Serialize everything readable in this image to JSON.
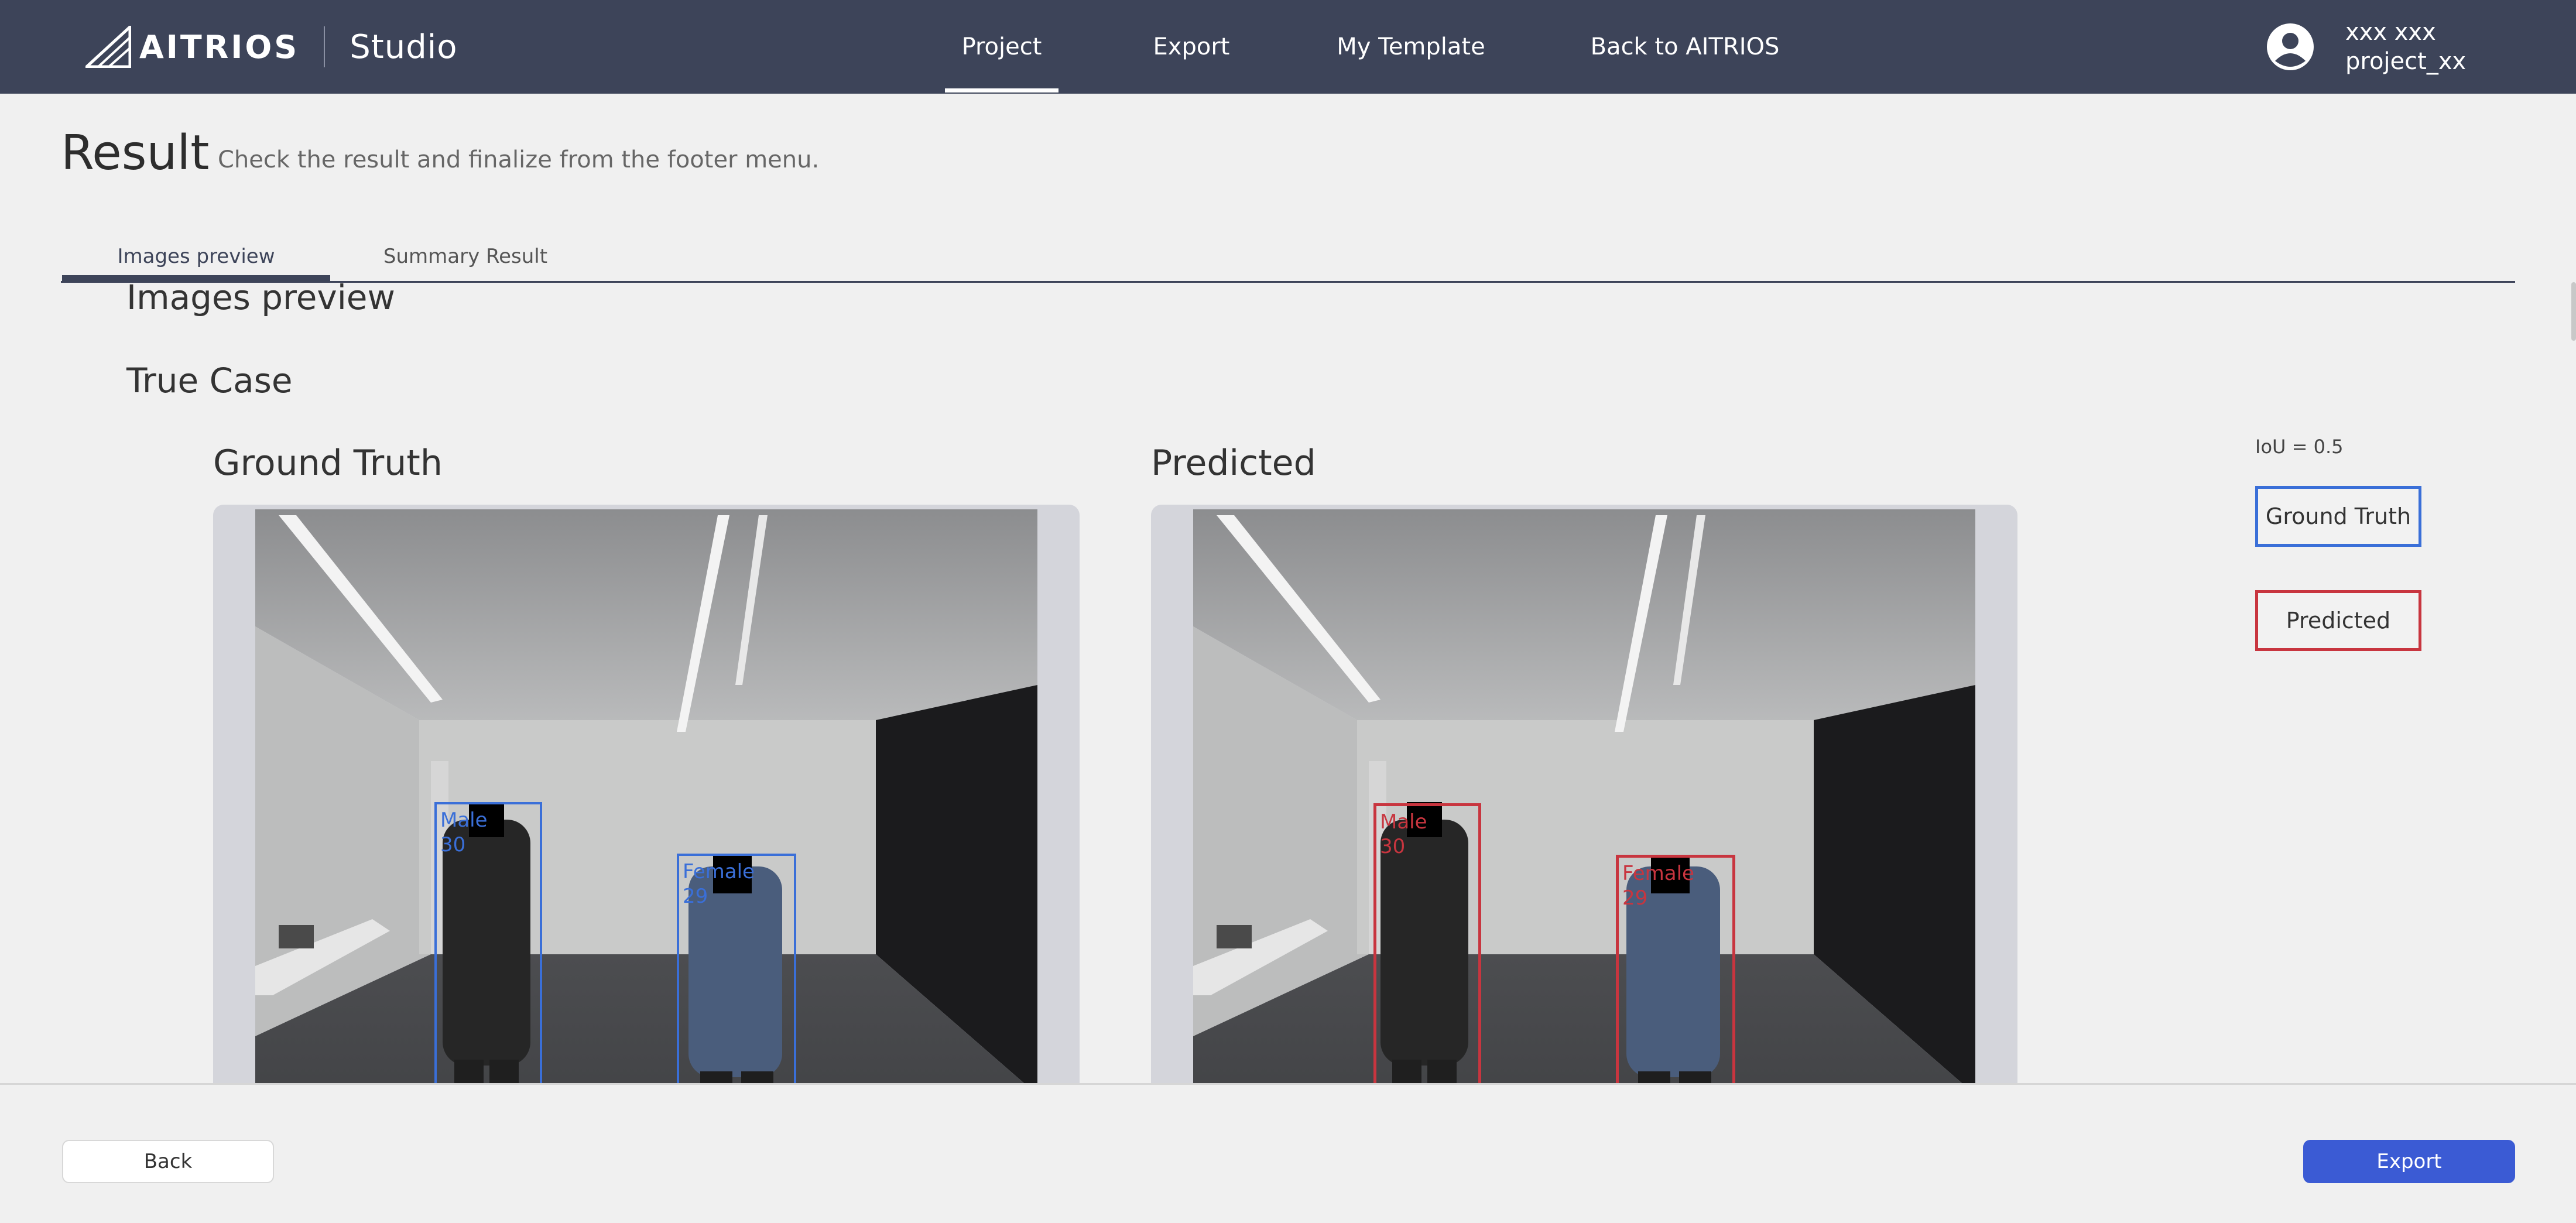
{
  "header": {
    "brand": "AITRIOS",
    "product": "Studio",
    "nav": [
      {
        "label": "Project",
        "active": true
      },
      {
        "label": "Export",
        "active": false
      },
      {
        "label": "My Template",
        "active": false
      },
      {
        "label": "Back to AITRIOS",
        "active": false
      }
    ],
    "user": {
      "name": "xxx xxx",
      "project": "project_xx",
      "icon": "account-circle-icon"
    }
  },
  "page": {
    "title": "Result",
    "subtitle": "Check the result and finalize from the footer menu."
  },
  "tabs": [
    {
      "label": "Images preview",
      "active": true
    },
    {
      "label": "Summary Result",
      "active": false
    }
  ],
  "content": {
    "section_title": "Images preview",
    "case_title": "True Case",
    "ground_truth_title": "Ground Truth",
    "predicted_title": "Predicted",
    "ground_truth_boxes": [
      {
        "gender": "Male",
        "age": "30"
      },
      {
        "gender": "Female",
        "age": "29"
      }
    ],
    "predicted_boxes": [
      {
        "gender": "Male",
        "age": "30"
      },
      {
        "gender": "Female",
        "age": "29"
      }
    ]
  },
  "legend": {
    "iou": "IoU = 0.5",
    "ground_truth": "Ground Truth",
    "predicted": "Predicted",
    "ground_truth_color": "#3a6fd8",
    "predicted_color": "#c8353f"
  },
  "footer": {
    "back_label": "Back",
    "export_label": "Export"
  },
  "colors": {
    "header_bg": "#3d4459",
    "primary": "#3b5bd4"
  }
}
